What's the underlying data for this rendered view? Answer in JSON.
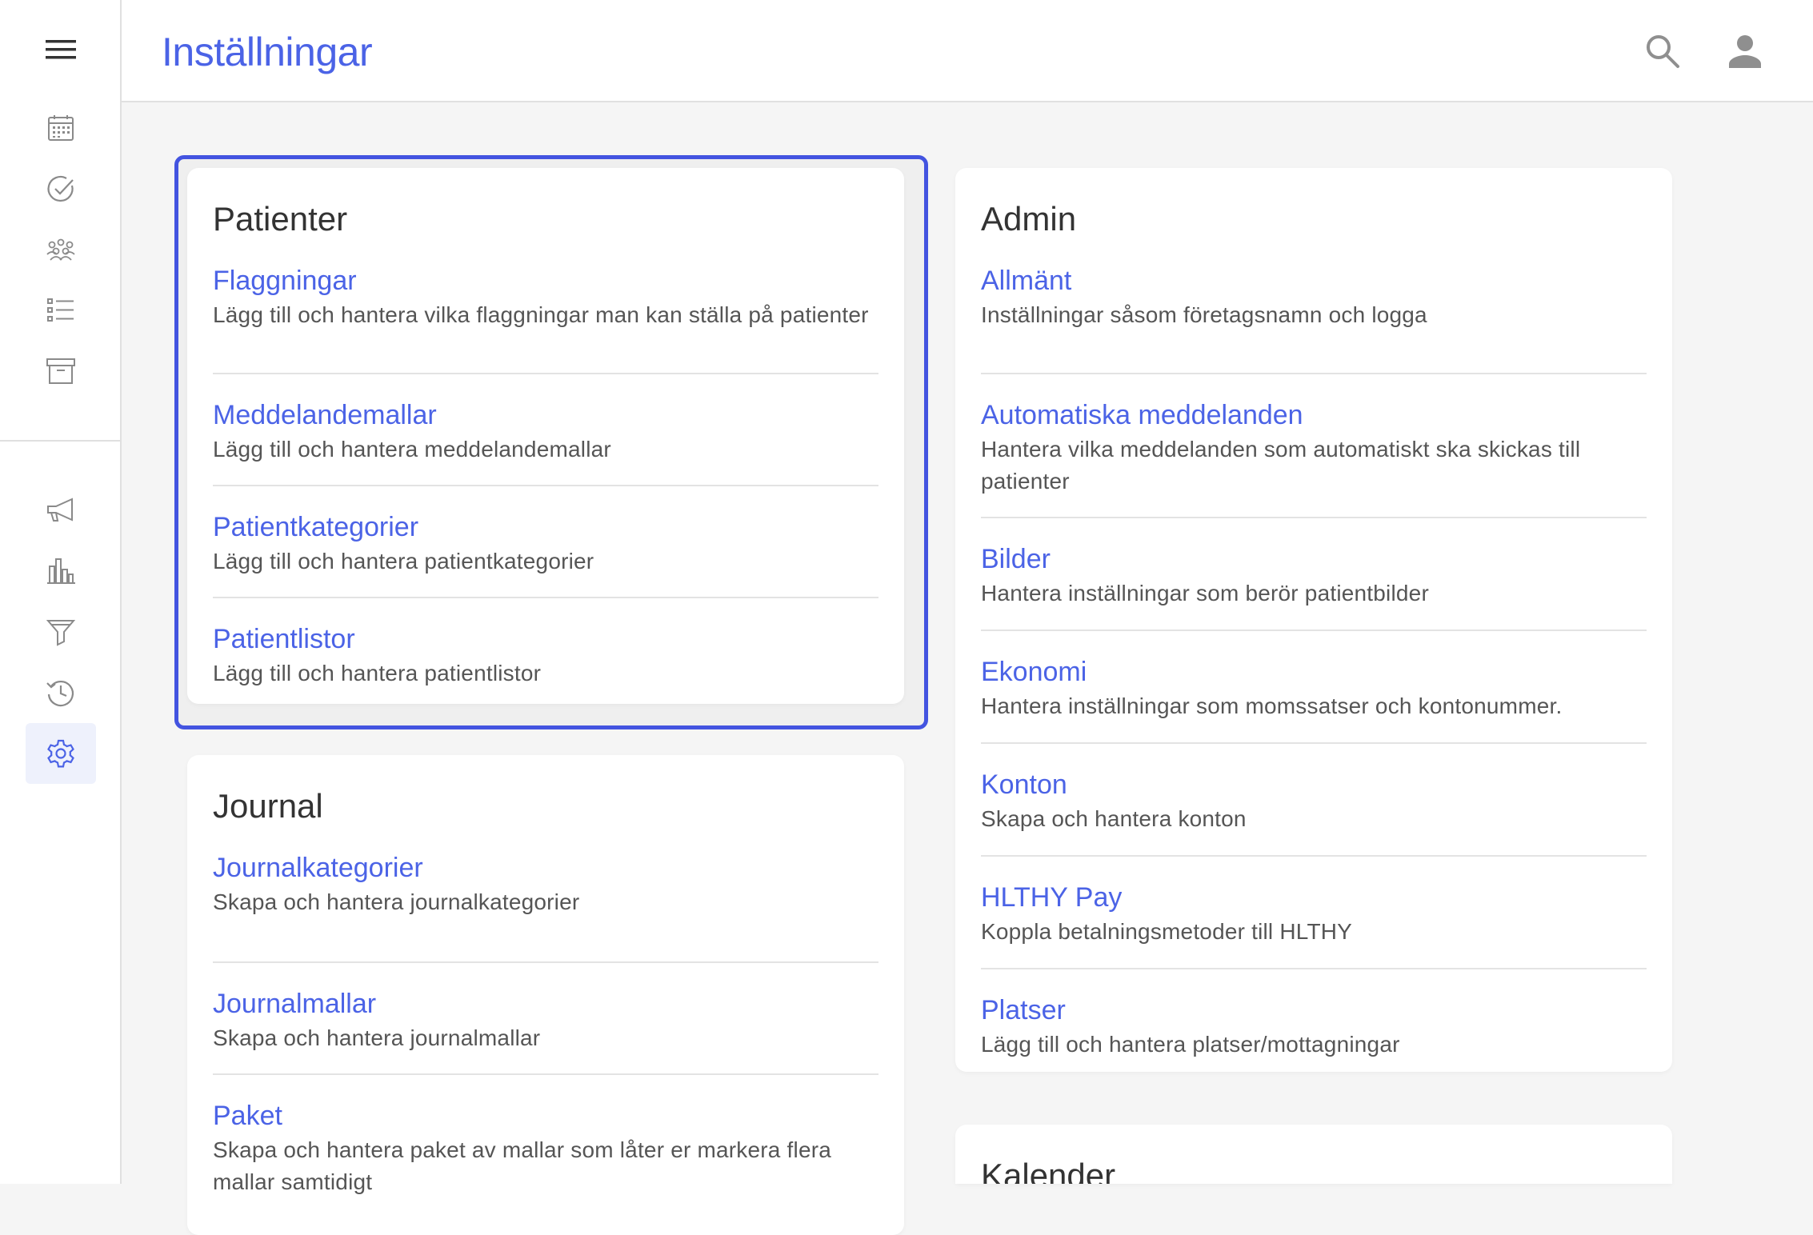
{
  "header": {
    "title": "Inställningar"
  },
  "sidebar": {
    "top_icons": [
      "calendar-icon",
      "check-circle-icon",
      "group-icon",
      "list-icon",
      "archive-icon"
    ],
    "bottom_icons": [
      "megaphone-icon",
      "bar-chart-icon",
      "filter-icon",
      "history-icon",
      "settings-icon"
    ],
    "active": "settings-icon"
  },
  "colors": {
    "accent": "#4b63e6",
    "focus": "#4354e0"
  },
  "sections": {
    "patienter": {
      "title": "Patienter",
      "items": [
        {
          "title": "Flaggningar",
          "desc": "Lägg till och hantera vilka flaggningar man kan ställa på patienter"
        },
        {
          "title": "Meddelandemallar",
          "desc": "Lägg till och hantera meddelandemallar"
        },
        {
          "title": "Patientkategorier",
          "desc": "Lägg till och hantera patientkategorier"
        },
        {
          "title": "Patientlistor",
          "desc": "Lägg till och hantera patientlistor"
        }
      ]
    },
    "journal": {
      "title": "Journal",
      "items": [
        {
          "title": "Journalkategorier",
          "desc": "Skapa och hantera journalkategorier"
        },
        {
          "title": "Journalmallar",
          "desc": "Skapa och hantera journalmallar"
        },
        {
          "title": "Paket",
          "desc": "Skapa och hantera paket av mallar som låter er markera flera mallar samtidigt"
        }
      ]
    },
    "admin": {
      "title": "Admin",
      "items": [
        {
          "title": "Allmänt",
          "desc": "Inställningar såsom företagsnamn och logga"
        },
        {
          "title": "Automatiska meddelanden",
          "desc": "Hantera vilka meddelanden som automatiskt ska skickas till patienter"
        },
        {
          "title": "Bilder",
          "desc": "Hantera inställningar som berör patientbilder"
        },
        {
          "title": "Ekonomi",
          "desc": "Hantera inställningar som momssatser och kontonummer."
        },
        {
          "title": "Konton",
          "desc": "Skapa och hantera konton"
        },
        {
          "title": "HLTHY Pay",
          "desc": "Koppla betalningsmetoder till HLTHY"
        },
        {
          "title": "Platser",
          "desc": "Lägg till och hantera platser/mottagningar"
        }
      ]
    },
    "kalender": {
      "title": "Kalender"
    }
  }
}
